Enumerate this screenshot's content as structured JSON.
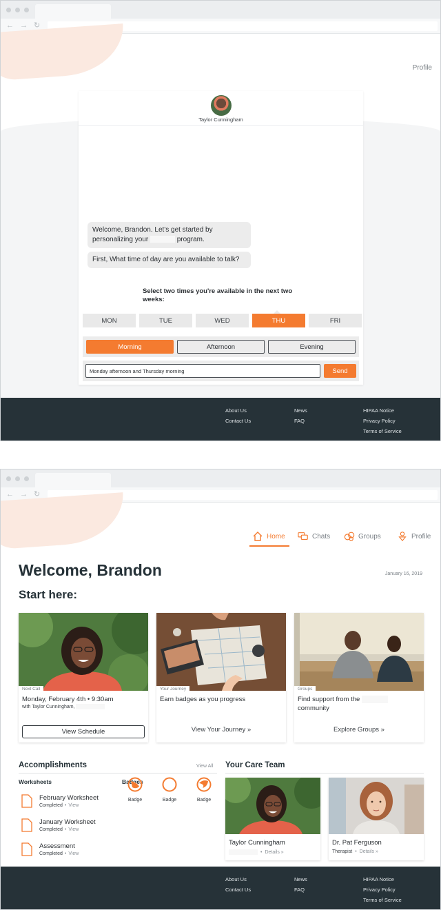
{
  "screen1": {
    "profile_link": "Profile",
    "chat": {
      "contact_name": "Taylor Cunningham",
      "messages": [
        {
          "before": "Welcome, Brandon. Let's get started by personalizing your",
          "after": "program."
        },
        {
          "text": "First, What time of day are you available to talk?"
        }
      ],
      "prompt": "Select two times you're available in the next two weeks:",
      "days": [
        "MON",
        "TUE",
        "WED",
        "THU",
        "FRI"
      ],
      "selected_day": "THU",
      "times": [
        "Morning",
        "Afternoon",
        "Evening"
      ],
      "selected_time": "Morning",
      "input_value": "Monday afternoon and Thursday morning",
      "send_label": "Send"
    }
  },
  "footer": {
    "col1": [
      "About Us",
      "Contact Us"
    ],
    "col2": [
      "News",
      "FAQ"
    ],
    "col3": [
      "HIPAA Notice",
      "Privacy Policy",
      "Terms of Service"
    ]
  },
  "screen2": {
    "nav": {
      "home": "Home",
      "chats": "Chats",
      "groups": "Groups",
      "profile": "Profile",
      "active": "Home"
    },
    "welcome": "Welcome, Brandon",
    "date": "January 16, 2019",
    "start_here": "Start here:",
    "cards": [
      {
        "tag": "Next Call",
        "title": "Monday, February 4th • 9:30am",
        "subtitle": "with Taylor Cunningham,",
        "action": "View Schedule"
      },
      {
        "tag": "Your Journey",
        "title": "Earn badges as you progress",
        "action": "View Your Journey »"
      },
      {
        "tag": "Groups",
        "title": "Find support from the",
        "title_line2": "community",
        "action": "Explore Groups »"
      }
    ],
    "accomplishments": {
      "title": "Accomplishments",
      "view_all": "View All",
      "worksheets_title": "Worksheets",
      "worksheets": [
        {
          "name": "February Worksheet",
          "status": "Completed",
          "link": "View"
        },
        {
          "name": "January Worksheet",
          "status": "Completed",
          "link": "View"
        },
        {
          "name": "Assessment",
          "status": "Completed",
          "link": "View"
        }
      ],
      "badges_title": "Badges",
      "badges": [
        "Badge",
        "Badge",
        "Badge"
      ]
    },
    "care_team": {
      "title": "Your Care Team",
      "members": [
        {
          "name": "Taylor Cunningham",
          "role": "",
          "link": "Details »"
        },
        {
          "name": "Dr. Pat Ferguson",
          "role": "Therapist",
          "link": "Details »"
        }
      ]
    }
  },
  "colors": {
    "accent": "#f47b30",
    "footer": "#263238",
    "blob": "#fbe9e0"
  },
  "icons": [
    "home-icon",
    "chats-icon",
    "groups-icon",
    "profile-icon",
    "document-icon",
    "badge-icon"
  ]
}
